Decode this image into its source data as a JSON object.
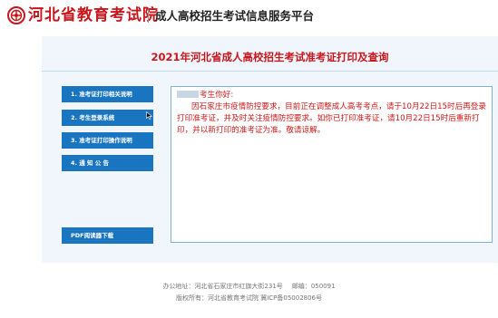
{
  "header": {
    "logo_text": "河北省教育考试院",
    "site_title": "成人高校招生考试信息服务平台",
    "brand_color": "#c8161d"
  },
  "main": {
    "exam_title": "2021年河北省成人高校招生考试准考证打印及查询"
  },
  "sidebar": {
    "items": [
      {
        "label": "1. 准考证打印相关说明"
      },
      {
        "label": "2. 考生登录系统"
      },
      {
        "label": "3. 准考证打印操作说明"
      },
      {
        "label": "4. 通 知 公 告"
      }
    ],
    "download_label": "PDF阅读器下载",
    "accent": "#1a75c1"
  },
  "notice": {
    "greeting": "考生你好:",
    "body": "因石家庄市疫情防控要求，目前正在调整成人高考考点，请于10月22日15时后再登录打印准考证，并及时关注疫情防控要求。如你已打印准考证，请10月22日15时后重新打印，并以新打印的准考证为准。敬请谅解。",
    "text_color": "#d01818"
  },
  "footer": {
    "address_label": "办公地址：",
    "address": "河北省石家庄市红旗大街231号",
    "postcode_label": "邮编：",
    "postcode": "050091",
    "copyright_label": "版权所有：",
    "copyright": "河北省教育考试院",
    "icp": "冀ICP备05002806号"
  }
}
